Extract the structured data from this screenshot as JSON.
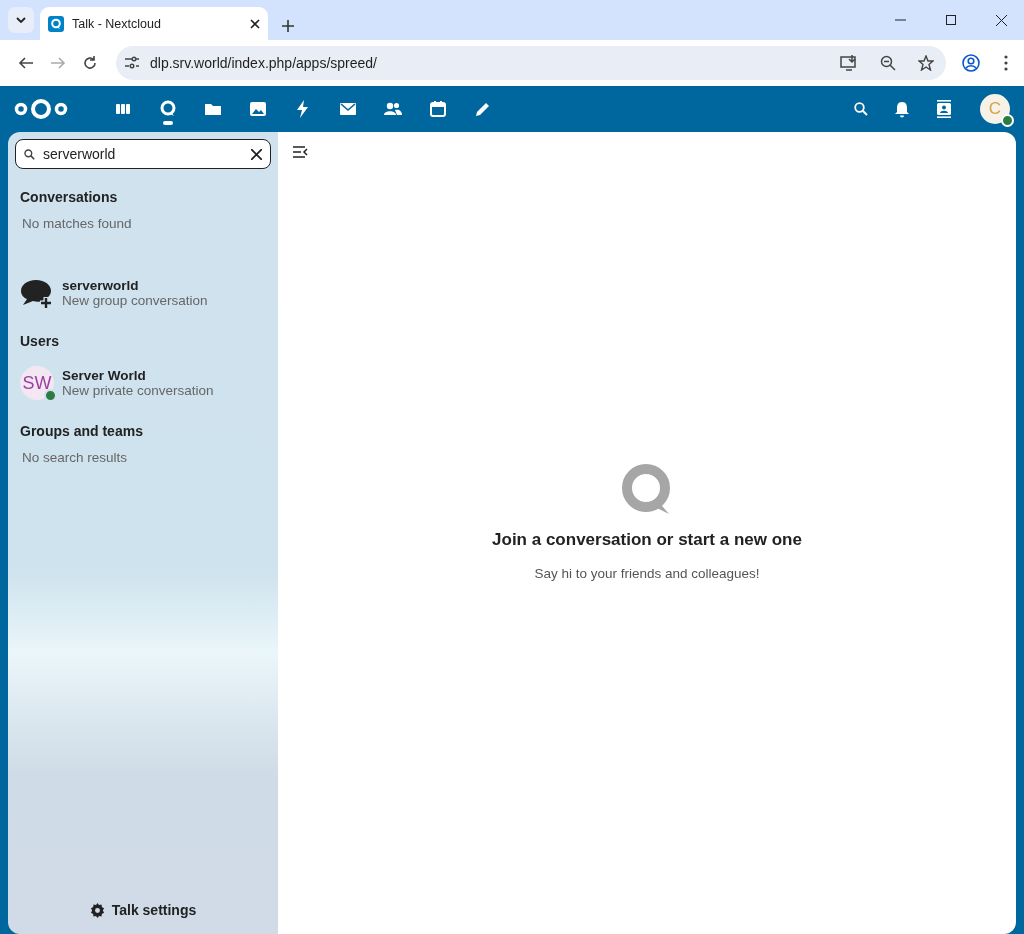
{
  "browser": {
    "tab": {
      "title": "Talk - Nextcloud"
    },
    "url": "dlp.srv.world/index.php/apps/spreed/"
  },
  "header": {
    "apps": [
      {
        "kind": "dashboard",
        "selected": false
      },
      {
        "kind": "talk",
        "selected": true
      },
      {
        "kind": "files",
        "selected": false
      },
      {
        "kind": "photos",
        "selected": false
      },
      {
        "kind": "activity",
        "selected": false
      },
      {
        "kind": "mail",
        "selected": false
      },
      {
        "kind": "contacts",
        "selected": false
      },
      {
        "kind": "calendar",
        "selected": false
      },
      {
        "kind": "notes",
        "selected": false
      }
    ],
    "user": {
      "initial": "C",
      "online": true
    }
  },
  "sidebar": {
    "search": {
      "value": "serverworld"
    },
    "sections": [
      {
        "title": "Conversations",
        "empty": "No matches found"
      },
      {
        "items": [
          {
            "kind": "new-group",
            "name": "serverworld",
            "subtitle": "New group conversation"
          }
        ]
      },
      {
        "title": "Users",
        "items": [
          {
            "kind": "user",
            "initials": "SW",
            "online": true,
            "name": "Server World",
            "subtitle": "New private conversation"
          }
        ]
      },
      {
        "title": "Groups and teams",
        "empty": "No search results"
      }
    ],
    "settings": "Talk settings"
  },
  "main": {
    "heading": "Join a conversation or start a new one",
    "text": "Say hi to your friends and colleagues!"
  }
}
